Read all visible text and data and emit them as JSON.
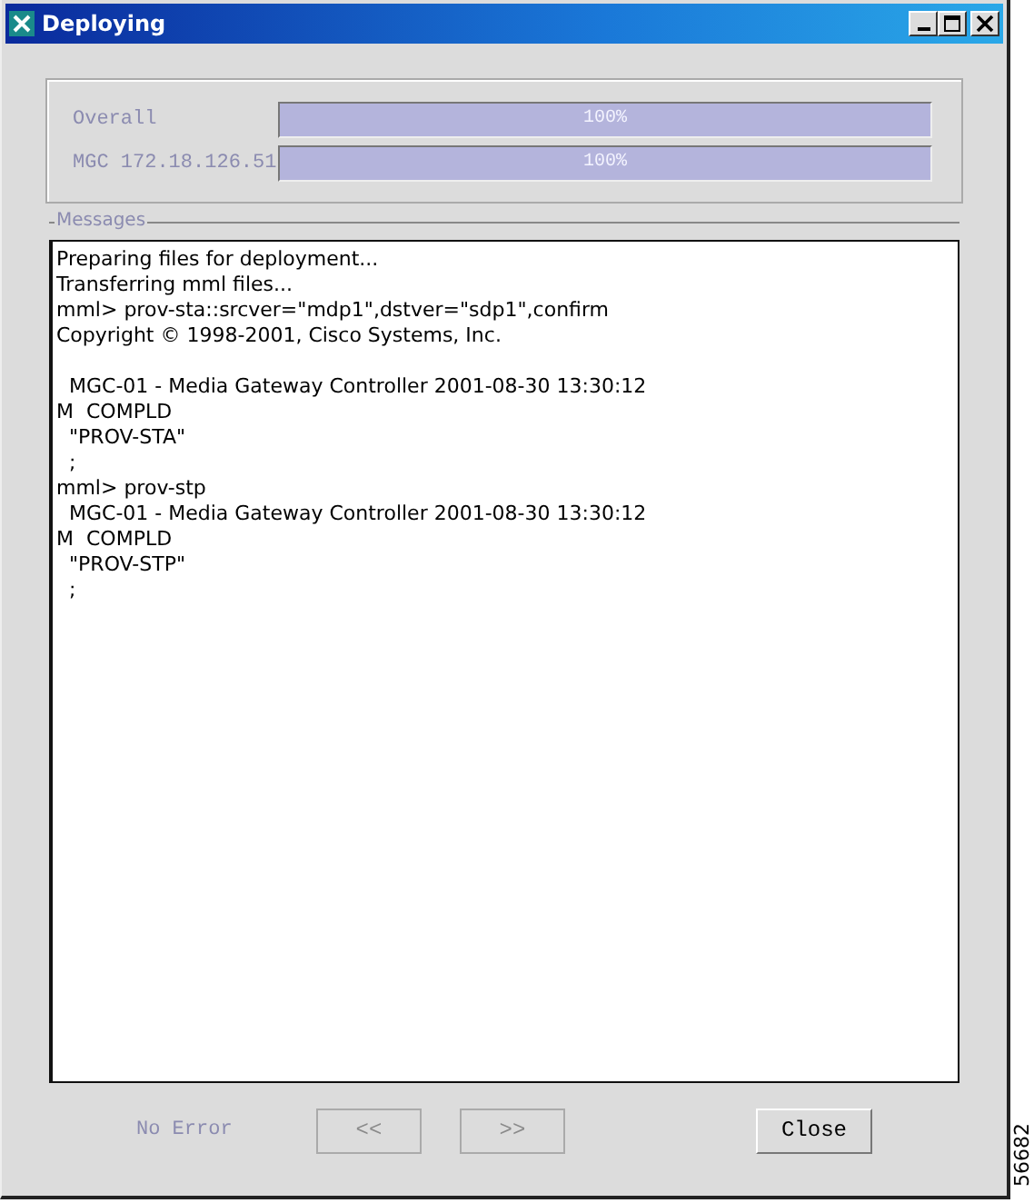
{
  "window": {
    "title": "Deploying"
  },
  "progress": [
    {
      "label": "Overall",
      "level": 1,
      "reading": "100%"
    },
    {
      "label": "MGC 172.18.126.51",
      "level": 1,
      "reading": "100%"
    }
  ],
  "messages": {
    "title": "Messages",
    "blocks": [
      [
        "Preparing files for deployment...",
        "Transferring mml files...",
        "mml> prov-sta::srcver=\"mdp1\",dstver=\"sdp1\",confirm",
        "Copyright © 1998-2001, Cisco Systems, Inc."
      ],
      [
        "  MGC-01 - Media Gateway Controller 2001-08-30 13:30:12",
        "M  COMPLD",
        "  \"PROV-STA\"",
        "  ;",
        "mml> prov-stp",
        "  MGC-01 - Media Gateway Controller 2001-08-30 13:30:12",
        "M  COMPLD",
        "  \"PROV-STP\"",
        "  ;"
      ]
    ]
  },
  "footer": {
    "status": "No Error",
    "buttons": [
      {
        "label": "<<",
        "disabled": true
      },
      {
        "label": ">>",
        "disabled": true
      },
      {
        "label": "Close",
        "disabled": false
      }
    ]
  },
  "figure_number": "56682"
}
